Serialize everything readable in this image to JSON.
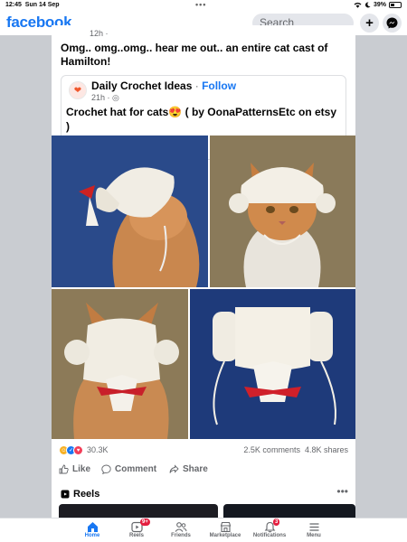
{
  "status_bar": {
    "time": "12:45",
    "date": "Sun 14 Sep",
    "dots": "•••",
    "battery": "39%",
    "battery_fraction": 0.39
  },
  "header": {
    "brand": "facebook",
    "search_placeholder": "Search"
  },
  "post": {
    "partial_time": "12h ·",
    "text": "Omg.. omg..omg.. hear me out.. an entire cat cast of Hamilton!",
    "shared": {
      "page_name": "Daily Crochet Ideas",
      "separator": "·",
      "follow": "Follow",
      "time": "21h ·",
      "text": "Crochet hat for cats😍 ( by OonaPatternsEtc on etsy )"
    },
    "reaction_count": "30.3K",
    "comments": "2.5K comments",
    "shares": "4.8K shares",
    "actions": {
      "like": "Like",
      "comment": "Comment",
      "share": "Share"
    }
  },
  "reels": {
    "title": "Reels",
    "more": "•••"
  },
  "tabbar": {
    "items": [
      {
        "label": "Home",
        "icon": "home-icon",
        "active": true
      },
      {
        "label": "Reels",
        "icon": "reels-icon",
        "badge": "9+"
      },
      {
        "label": "Friends",
        "icon": "friends-icon"
      },
      {
        "label": "Marketplace",
        "icon": "marketplace-icon"
      },
      {
        "label": "Notifications",
        "icon": "bell-icon",
        "badge": "3"
      },
      {
        "label": "Menu",
        "icon": "menu-icon"
      }
    ]
  },
  "colors": {
    "brand": "#1877f2",
    "badge": "#e41e3f",
    "background": "#c9ccd1"
  }
}
